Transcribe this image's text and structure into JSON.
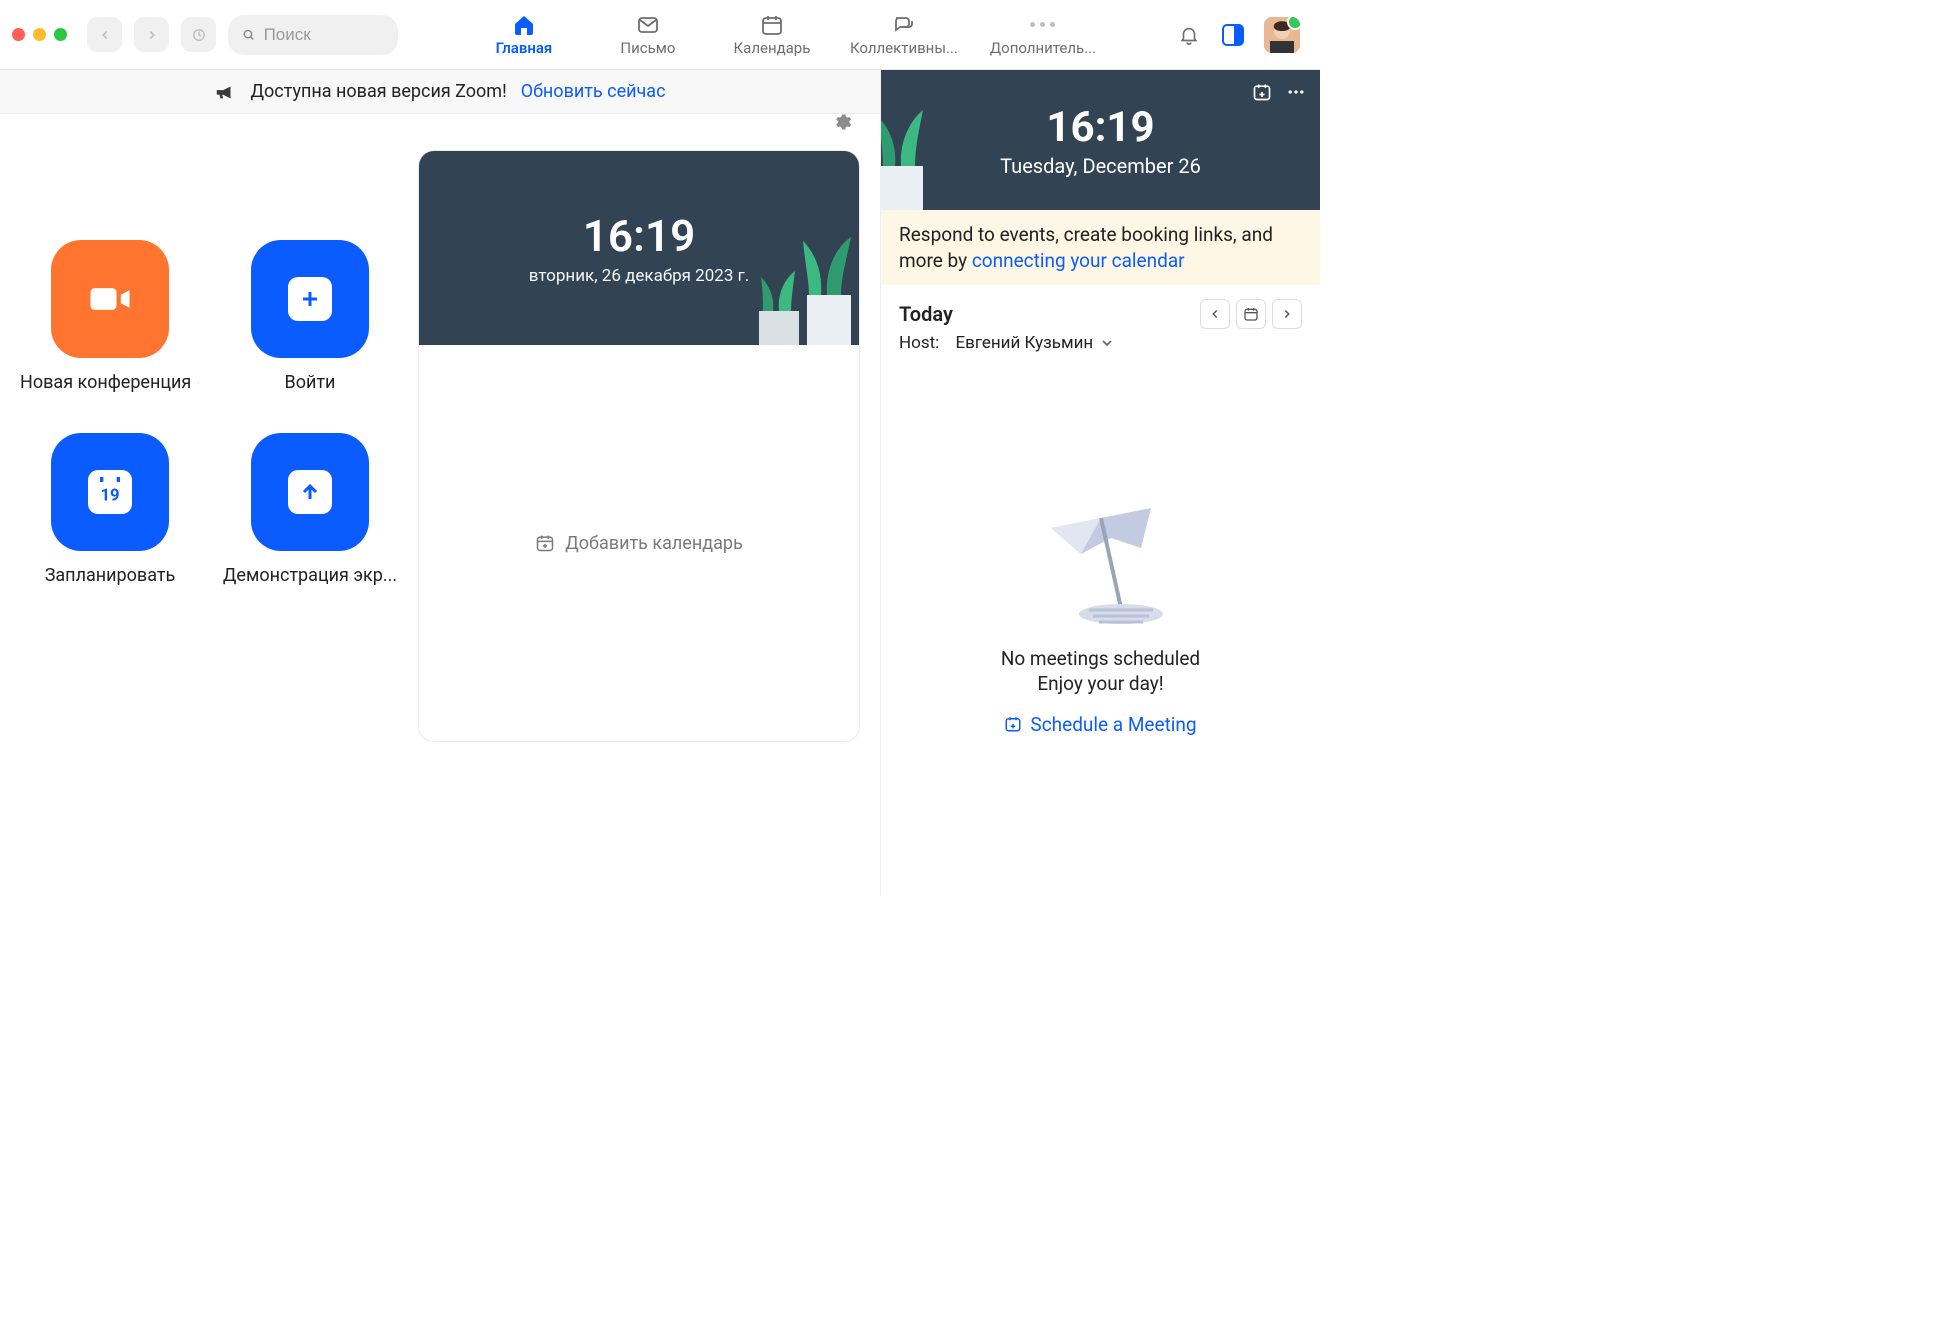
{
  "search": {
    "placeholder": "Поиск"
  },
  "tabs": {
    "home": "Главная",
    "mail": "Письмо",
    "calendar": "Календарь",
    "team": "Коллективны...",
    "more": "Дополнитель..."
  },
  "banner": {
    "text": "Доступна новая версия Zoom!",
    "link": "Обновить сейчас"
  },
  "actions": {
    "new_meeting": "Новая конференция",
    "join": "Войти",
    "schedule": "Запланировать",
    "schedule_day": "19",
    "share": "Демонстрация экр..."
  },
  "clock": {
    "time": "16:19",
    "date_ru": "вторник, 26 декабря 2023 г.",
    "add_calendar": "Добавить календарь"
  },
  "right": {
    "time": "16:19",
    "date_en": "Tuesday, December 26",
    "connect_text_prefix": "Respond to events, create booking links, and more by ",
    "connect_link": "connecting your calendar",
    "today": "Today",
    "host_label": "Host:",
    "host_name": "Евгений Кузьмин",
    "no_meetings_line1": "No meetings scheduled",
    "no_meetings_line2": "Enjoy your day!",
    "schedule_meeting": "Schedule a Meeting"
  }
}
